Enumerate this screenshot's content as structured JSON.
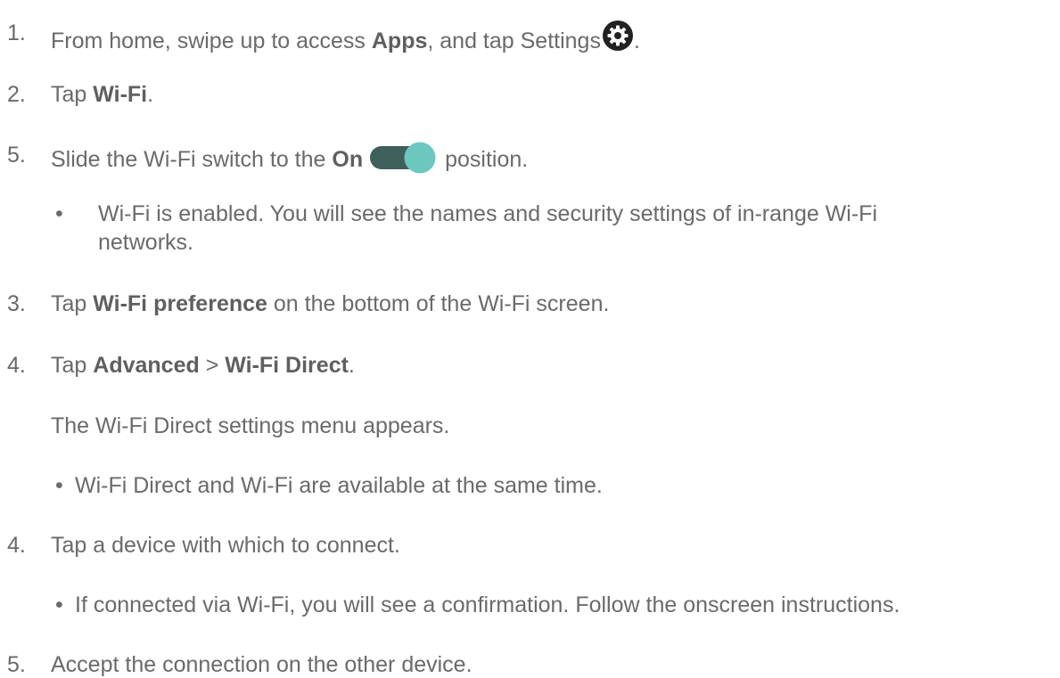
{
  "steps": [
    {
      "num": "1.",
      "pre": "From home, swipe up to access ",
      "bold": "Apps",
      "mid": ", and tap Settings",
      "post": "."
    },
    {
      "num": "2.",
      "pre": "Tap ",
      "bold": "Wi-Fi",
      "post": "."
    },
    {
      "num": "5.",
      "pre": "Slide the Wi-Fi switch to the ",
      "bold": "On",
      "post": "position."
    },
    {
      "num": "3.",
      "pre": "Tap ",
      "bold": "Wi-Fi preference",
      "post": " on the bottom of the Wi-Fi screen."
    },
    {
      "num": "4.",
      "pre": "Tap ",
      "bold1": "Advanced",
      "sep": " > ",
      "bold2": "Wi-Fi Direct",
      "post": "."
    },
    {
      "num": "4.",
      "text": "Tap a device with which to connect."
    },
    {
      "num": "5.",
      "text": "Accept the connection on the other device."
    }
  ],
  "bullets": {
    "wifi_enabled_line1": "Wi-Fi is enabled. You will see the names and security settings of in-range Wi-Fi",
    "wifi_enabled_line2": "networks.",
    "menu_appears": "The Wi-Fi Direct settings menu appears.",
    "available_same_time": "Wi-Fi Direct and Wi-Fi are available at the same time.",
    "confirmation": "If connected via Wi-Fi, you will see a confirmation. Follow the onscreen instructions.",
    "bullet_char": "•"
  },
  "icons": {
    "settings": "gear-icon",
    "switch": "toggle-switch-icon"
  },
  "colors": {
    "text": "#6a6a6a",
    "gear": "#222222",
    "toggle_track": "#3f5f5b",
    "toggle_knob": "#6cc7bf"
  }
}
